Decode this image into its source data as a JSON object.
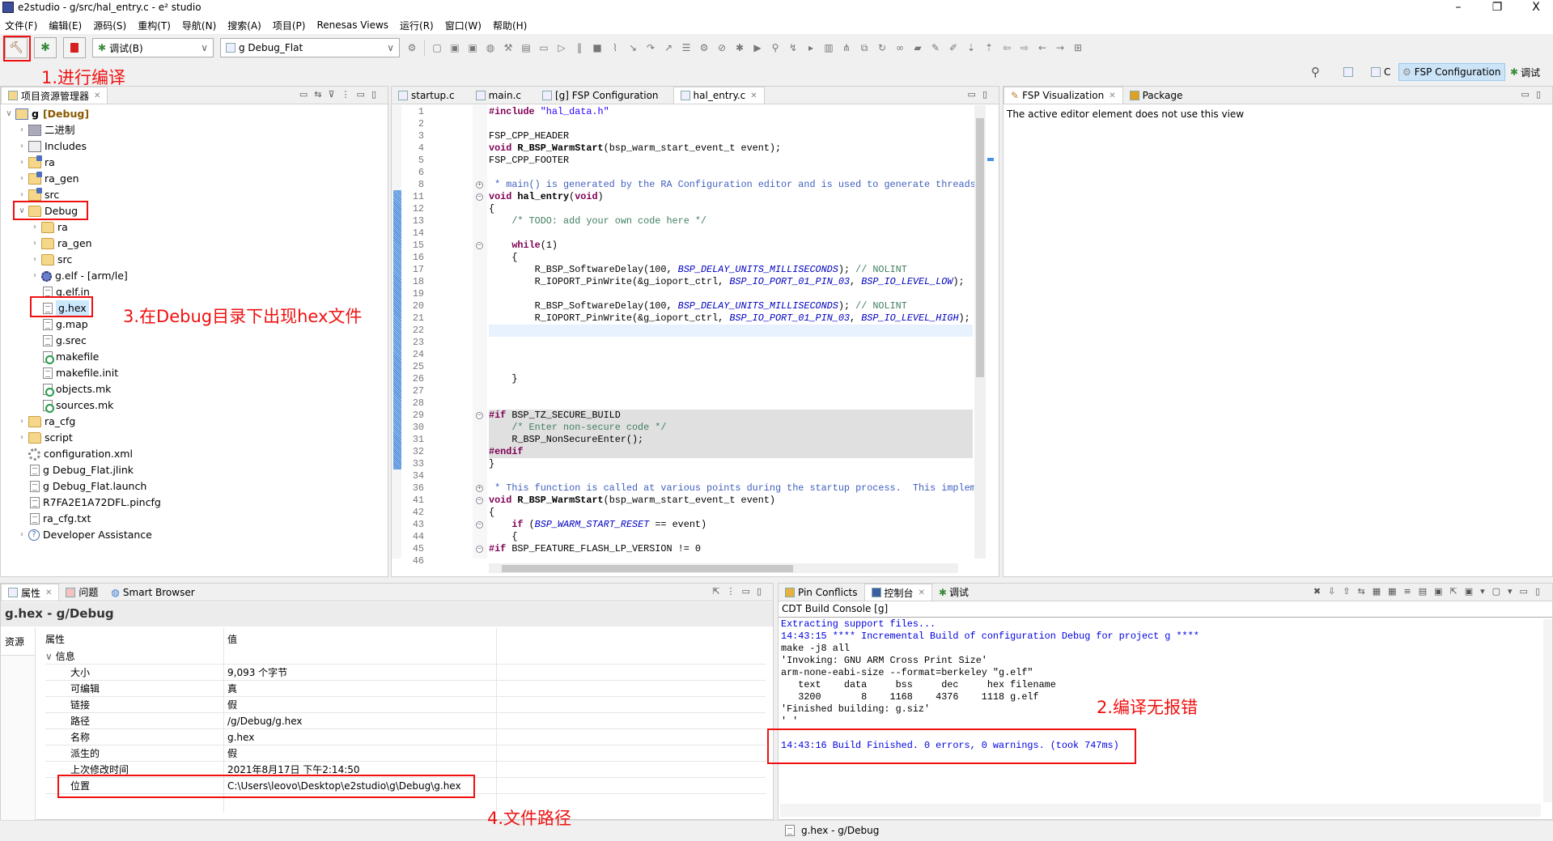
{
  "window": {
    "title": "e2studio - g/src/hal_entry.c - e² studio",
    "minimize": "–",
    "restore": "❐",
    "close": "X"
  },
  "menu": [
    "文件(F)",
    "编辑(E)",
    "源码(S)",
    "重构(T)",
    "导航(N)",
    "搜索(A)",
    "项目(P)",
    "Renesas Views",
    "运行(R)",
    "窗口(W)",
    "帮助(H)"
  ],
  "toolbar": {
    "build_icon": "hammer-icon",
    "debug_icon": "bug-icon",
    "stop_icon": "stop-icon",
    "build_config": "调试(B)",
    "launch_config": "g Debug_Flat",
    "icons": [
      "new-icon",
      "save-icon",
      "save-all-icon",
      "globe-icon",
      "hammer-dropdown-icon",
      "binary-icon",
      "monitor-icon",
      "resume-icon",
      "suspend-icon",
      "terminate-icon",
      "disconnect-icon",
      "step-into-icon",
      "step-over-icon",
      "step-return-icon",
      "menu-icon",
      "settings-icon",
      "skip-breakpoints-icon",
      "debug-run-icon",
      "run-icon",
      "search-icon",
      "step-icon",
      "instruction-step-icon",
      "columns-icon",
      "hierarchy-icon",
      "copy-icon",
      "refresh-icon",
      "link-icon",
      "open-folder-icon",
      "pen-icon",
      "edit-icon",
      "next-annotation-icon",
      "prev-annotation-icon",
      "back-history-icon",
      "forward-history-icon",
      "back-icon",
      "forward-icon",
      "open-perspective-icon"
    ]
  },
  "perspectives": {
    "c": "C",
    "fsp": "FSP Configuration",
    "debug": "调试"
  },
  "project_explorer": {
    "title": "项目资源管理器",
    "tree": [
      {
        "label": "g",
        "suffix": "[Debug]",
        "depth": 0,
        "exp": "open",
        "icon": "proj"
      },
      {
        "label": "二进制",
        "depth": 1,
        "exp": "closed",
        "icon": "bin"
      },
      {
        "label": "Includes",
        "depth": 1,
        "exp": "closed",
        "icon": "inc"
      },
      {
        "label": "ra",
        "depth": 1,
        "exp": "closed",
        "icon": "srcfolder"
      },
      {
        "label": "ra_gen",
        "depth": 1,
        "exp": "closed",
        "icon": "srcfolder"
      },
      {
        "label": "src",
        "depth": 1,
        "exp": "closed",
        "icon": "srcfolder"
      },
      {
        "label": "Debug",
        "depth": 1,
        "exp": "open",
        "icon": "folder"
      },
      {
        "label": "ra",
        "depth": 2,
        "exp": "closed",
        "icon": "folder"
      },
      {
        "label": "ra_gen",
        "depth": 2,
        "exp": "closed",
        "icon": "folder"
      },
      {
        "label": "src",
        "depth": 2,
        "exp": "closed",
        "icon": "folder"
      },
      {
        "label": "g.elf - [arm/le]",
        "depth": 2,
        "exp": "closed",
        "icon": "elf"
      },
      {
        "label": "g.elf.in",
        "depth": 2,
        "exp": "",
        "icon": "file"
      },
      {
        "label": "g.hex",
        "depth": 2,
        "exp": "",
        "icon": "file",
        "selected": true
      },
      {
        "label": "g.map",
        "depth": 2,
        "exp": "",
        "icon": "file"
      },
      {
        "label": "g.srec",
        "depth": 2,
        "exp": "",
        "icon": "file"
      },
      {
        "label": "makefile",
        "depth": 2,
        "exp": "",
        "icon": "make"
      },
      {
        "label": "makefile.init",
        "depth": 2,
        "exp": "",
        "icon": "file"
      },
      {
        "label": "objects.mk",
        "depth": 2,
        "exp": "",
        "icon": "make"
      },
      {
        "label": "sources.mk",
        "depth": 2,
        "exp": "",
        "icon": "make"
      },
      {
        "label": "ra_cfg",
        "depth": 1,
        "exp": "closed",
        "icon": "folder"
      },
      {
        "label": "script",
        "depth": 1,
        "exp": "closed",
        "icon": "folder"
      },
      {
        "label": "configuration.xml",
        "depth": 1,
        "exp": "",
        "icon": "gear"
      },
      {
        "label": "g Debug_Flat.jlink",
        "depth": 1,
        "exp": "",
        "icon": "file"
      },
      {
        "label": "g Debug_Flat.launch",
        "depth": 1,
        "exp": "",
        "icon": "file"
      },
      {
        "label": "R7FA2E1A72DFL.pincfg",
        "depth": 1,
        "exp": "",
        "icon": "file"
      },
      {
        "label": "ra_cfg.txt",
        "depth": 1,
        "exp": "",
        "icon": "file"
      },
      {
        "label": "Developer Assistance",
        "depth": 1,
        "exp": "closed",
        "icon": "help"
      }
    ]
  },
  "editor": {
    "tabs": [
      {
        "label": "startup.c",
        "active": false
      },
      {
        "label": "main.c",
        "active": false
      },
      {
        "label": "[g] FSP Configuration",
        "active": false
      },
      {
        "label": "hal_entry.c",
        "active": true
      }
    ],
    "lines": [
      {
        "n": "1",
        "seg": [
          [
            "#include ",
            "kw"
          ],
          [
            "\"hal_data.h\"",
            "str"
          ]
        ]
      },
      {
        "n": "2",
        "seg": []
      },
      {
        "n": "3",
        "seg": [
          [
            "FSP_CPP_HEADER",
            ""
          ]
        ]
      },
      {
        "n": "4",
        "seg": [
          [
            "void",
            "kw"
          ],
          [
            " R_BSP_WarmStart",
            "b"
          ],
          [
            "(bsp_warm_start_event_t event);",
            ""
          ]
        ]
      },
      {
        "n": "5",
        "seg": [
          [
            "FSP_CPP_FOOTER",
            ""
          ]
        ]
      },
      {
        "n": "6",
        "seg": []
      },
      {
        "n": "8",
        "fold": "+",
        "seg": [
          [
            " * main() is generated by the RA Configuration editor and is used to generate threads",
            "doc"
          ]
        ]
      },
      {
        "n": "11",
        "fold": "-",
        "seg": [
          [
            "void",
            "kw"
          ],
          [
            " hal_entry",
            "b"
          ],
          [
            "(",
            ""
          ],
          [
            "void",
            "kw"
          ],
          [
            ")",
            ""
          ]
        ]
      },
      {
        "n": "12",
        "seg": [
          [
            "{",
            ""
          ]
        ]
      },
      {
        "n": "13",
        "seg": [
          [
            "    /* TODO: add your own code here */",
            "cm"
          ]
        ]
      },
      {
        "n": "14",
        "seg": []
      },
      {
        "n": "15",
        "fold": "-",
        "seg": [
          [
            "    ",
            ""
          ],
          [
            "while",
            "kw"
          ],
          [
            "(1)",
            ""
          ]
        ]
      },
      {
        "n": "16",
        "seg": [
          [
            "    {",
            ""
          ]
        ]
      },
      {
        "n": "17",
        "seg": [
          [
            "        R_BSP_SoftwareDelay(100, ",
            ""
          ],
          [
            "BSP_DELAY_UNITS_MILLISECONDS",
            "mac"
          ],
          [
            "); ",
            ""
          ],
          [
            "// NOLINT",
            "cm"
          ]
        ]
      },
      {
        "n": "18",
        "seg": [
          [
            "        R_IOPORT_PinWrite(&g_ioport_ctrl, ",
            ""
          ],
          [
            "BSP_IO_PORT_01_PIN_03",
            "mac"
          ],
          [
            ", ",
            ""
          ],
          [
            "BSP_IO_LEVEL_LOW",
            "mac"
          ],
          [
            ");",
            ""
          ]
        ]
      },
      {
        "n": "19",
        "seg": []
      },
      {
        "n": "20",
        "seg": [
          [
            "        R_BSP_SoftwareDelay(100, ",
            ""
          ],
          [
            "BSP_DELAY_UNITS_MILLISECONDS",
            "mac"
          ],
          [
            "); ",
            ""
          ],
          [
            "// NOLINT",
            "cm"
          ]
        ]
      },
      {
        "n": "21",
        "seg": [
          [
            "        R_IOPORT_PinWrite(&g_ioport_ctrl, ",
            ""
          ],
          [
            "BSP_IO_PORT_01_PIN_03",
            "mac"
          ],
          [
            ", ",
            ""
          ],
          [
            "BSP_IO_LEVEL_HIGH",
            "mac"
          ],
          [
            ");",
            ""
          ]
        ]
      },
      {
        "n": "22",
        "current": true,
        "seg": []
      },
      {
        "n": "23",
        "seg": []
      },
      {
        "n": "24",
        "seg": []
      },
      {
        "n": "25",
        "seg": []
      },
      {
        "n": "26",
        "seg": [
          [
            "    }",
            ""
          ]
        ]
      },
      {
        "n": "27",
        "seg": []
      },
      {
        "n": "28",
        "seg": []
      },
      {
        "n": "29",
        "fold": "-",
        "inactive": true,
        "seg": [
          [
            "#if",
            "kw"
          ],
          [
            " BSP_TZ_SECURE_BUILD",
            ""
          ]
        ]
      },
      {
        "n": "30",
        "inactive": true,
        "seg": [
          [
            "    /* Enter non-secure code */",
            "cm"
          ]
        ]
      },
      {
        "n": "31",
        "inactive": true,
        "seg": [
          [
            "    R_BSP_NonSecureEnter();",
            ""
          ]
        ]
      },
      {
        "n": "32",
        "inactive": true,
        "seg": [
          [
            "#endif",
            "kw"
          ]
        ]
      },
      {
        "n": "33",
        "seg": [
          [
            "}",
            ""
          ]
        ]
      },
      {
        "n": "34",
        "seg": []
      },
      {
        "n": "36",
        "fold": "+",
        "seg": [
          [
            " * This function is called at various points during the startup process.  This implem",
            "doc"
          ]
        ]
      },
      {
        "n": "41",
        "fold": "-",
        "seg": [
          [
            "void",
            "kw"
          ],
          [
            " R_BSP_WarmStart",
            "b"
          ],
          [
            "(bsp_warm_start_event_t event)",
            ""
          ]
        ]
      },
      {
        "n": "42",
        "seg": [
          [
            "{",
            ""
          ]
        ]
      },
      {
        "n": "43",
        "fold": "-",
        "seg": [
          [
            "    ",
            ""
          ],
          [
            "if",
            "kw"
          ],
          [
            " (",
            ""
          ],
          [
            "BSP_WARM_START_RESET",
            "mac"
          ],
          [
            " == event)",
            ""
          ]
        ]
      },
      {
        "n": "44",
        "seg": [
          [
            "    {",
            ""
          ]
        ]
      },
      {
        "n": "45",
        "fold": "-",
        "seg": [
          [
            "#if",
            "kw"
          ],
          [
            " BSP_FEATURE_FLASH_LP_VERSION != 0",
            ""
          ]
        ]
      },
      {
        "n": "46",
        "seg": []
      }
    ]
  },
  "fsp_view": {
    "tabs": [
      "FSP Visualization",
      "Package"
    ],
    "message": "The active editor element does not use this view"
  },
  "properties": {
    "tabs": [
      "属性",
      "问题",
      "Smart Browser"
    ],
    "title": "g.hex - g/Debug",
    "side_tab": "资源",
    "col_property": "属性",
    "col_value": "值",
    "group": "信息",
    "rows": [
      {
        "k": "大小",
        "v": "9,093 个字节"
      },
      {
        "k": "可编辑",
        "v": "真"
      },
      {
        "k": "链接",
        "v": "假"
      },
      {
        "k": "路径",
        "v": "/g/Debug/g.hex"
      },
      {
        "k": "名称",
        "v": "g.hex"
      },
      {
        "k": "派生的",
        "v": "假"
      },
      {
        "k": "上次修改时间",
        "v": "2021年8月17日 下午2:14:50"
      },
      {
        "k": "位置",
        "v": "C:\\Users\\leovo\\Desktop\\e2studio\\g\\Debug\\g.hex"
      }
    ]
  },
  "console": {
    "tabs": [
      "Pin Conflicts",
      "控制台",
      "调试"
    ],
    "title": "CDT Build Console [g]",
    "lines": [
      {
        "t": "Extracting support files...",
        "c": "blue"
      },
      {
        "t": "14:43:15 **** Incremental Build of configuration Debug for project g ****",
        "c": "blue"
      },
      {
        "t": "make -j8 all",
        "c": ""
      },
      {
        "t": "'Invoking: GNU ARM Cross Print Size'",
        "c": ""
      },
      {
        "t": "arm-none-eabi-size --format=berkeley \"g.elf\"",
        "c": ""
      },
      {
        "t": "   text\t   data\t    bss\t    dec\t    hex\tfilename",
        "c": ""
      },
      {
        "t": "   3200\t      8\t   1168\t   4376\t   1118\tg.elf",
        "c": ""
      },
      {
        "t": "'Finished building: g.siz'",
        "c": ""
      },
      {
        "t": "' '",
        "c": ""
      },
      {
        "t": "",
        "c": ""
      },
      {
        "t": "14:43:16 Build Finished. 0 errors, 0 warnings. (took 747ms)",
        "c": "blue"
      }
    ]
  },
  "status": {
    "text": "g.hex - g/Debug"
  },
  "annotations": {
    "step1": "1.进行编译",
    "step2": "2.编译无报错",
    "step3": "3.在Debug目录下出现hex文件",
    "step4": "4.文件路径"
  },
  "colors": {
    "annotation": "#f01010",
    "selection": "#cce8ff",
    "keyword": "#7f0055",
    "string": "#2a00ff",
    "comment": "#3f7f5f",
    "macro": "#0000c0"
  }
}
